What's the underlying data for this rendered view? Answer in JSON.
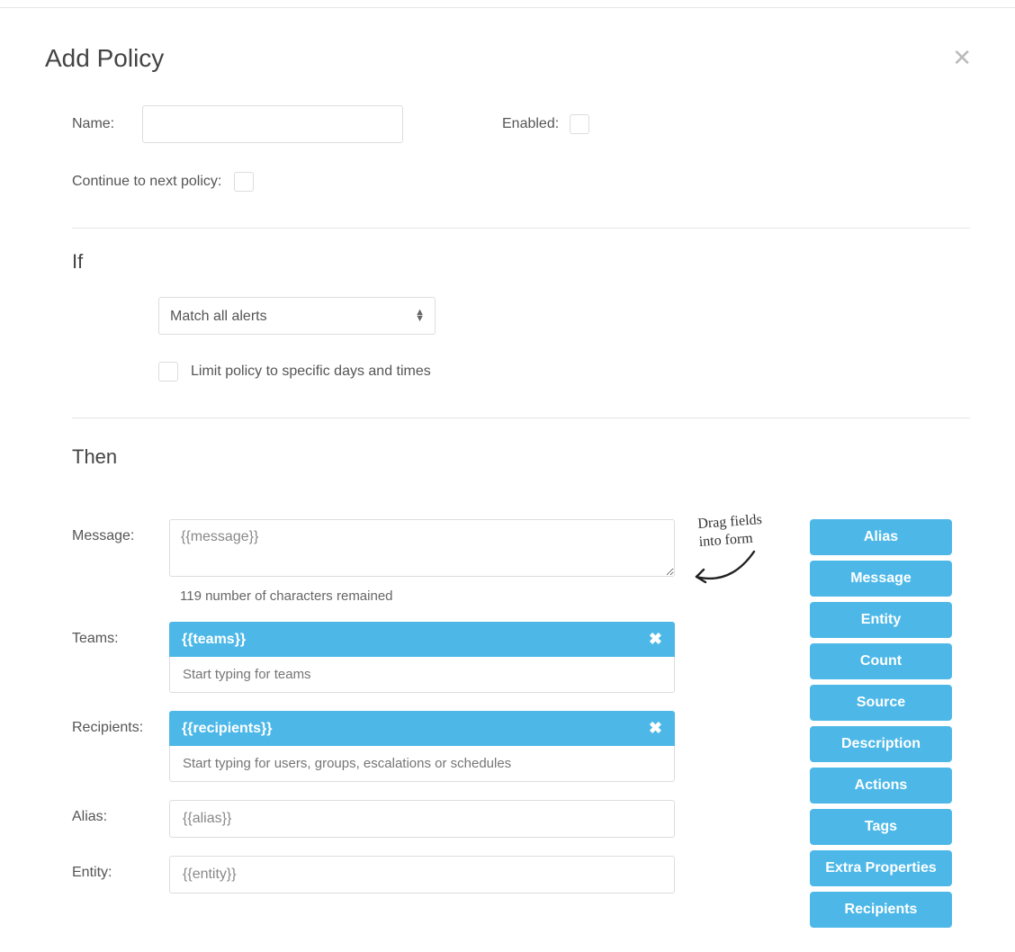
{
  "title": "Add Policy",
  "labels": {
    "name": "Name:",
    "enabled": "Enabled:",
    "continue": "Continue to next policy:",
    "if": "If",
    "then": "Then",
    "match": "Match all alerts",
    "limit": "Limit policy to specific days and times",
    "message": "Message:",
    "teams": "Teams:",
    "recipients": "Recipients:",
    "alias": "Alias:",
    "entity": "Entity:"
  },
  "values": {
    "name": "",
    "message": "{{message}}",
    "char_count": "119 number of characters remained",
    "teams_tag": "{{teams}}",
    "teams_placeholder": "Start typing for teams",
    "recipients_tag": "{{recipients}}",
    "recipients_placeholder": "Start typing for users, groups, escalations or schedules",
    "alias": "{{alias}}",
    "entity": "{{entity}}"
  },
  "hint": {
    "line1": "Drag fields",
    "line2": "into form"
  },
  "chips": [
    "Alias",
    "Message",
    "Entity",
    "Count",
    "Source",
    "Description",
    "Actions",
    "Tags",
    "Extra Properties",
    "Recipients"
  ]
}
